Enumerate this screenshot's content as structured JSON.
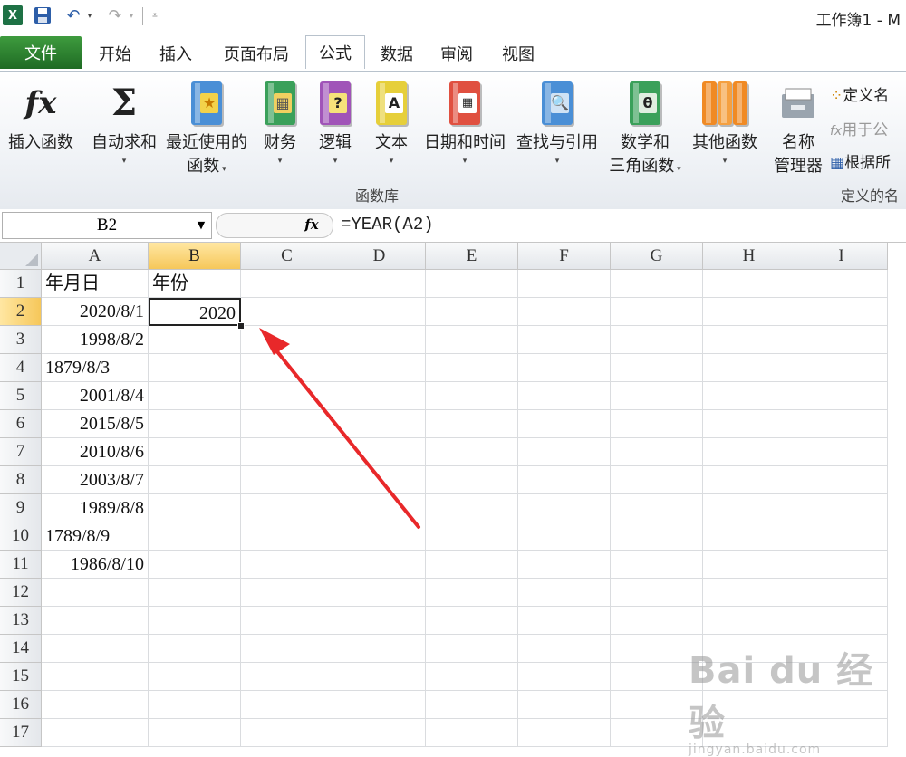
{
  "title_bar": {
    "document_title": "工作簿1 - M"
  },
  "tabs": [
    {
      "label": "文件"
    },
    {
      "label": "开始"
    },
    {
      "label": "插入"
    },
    {
      "label": "页面布局"
    },
    {
      "label": "公式",
      "active": true
    },
    {
      "label": "数据"
    },
    {
      "label": "审阅"
    },
    {
      "label": "视图"
    }
  ],
  "ribbon": {
    "insert_function": "插入函数",
    "autosum": "自动求和",
    "recent_1": "最近使用的",
    "recent_2": "函数",
    "financial": "财务",
    "logical": "逻辑",
    "text": "文本",
    "datetime": "日期和时间",
    "lookup": "查找与引用",
    "math_1": "数学和",
    "math_2": "三角函数",
    "more": "其他函数",
    "group_library": "函数库",
    "name_mgr_1": "名称",
    "name_mgr_2": "管理器",
    "define_name": "定义名",
    "use_in_formula": "用于公",
    "create_from_sel": "根据所",
    "group_defined": "定义的名"
  },
  "formula_bar": {
    "name_box": "B2",
    "fx": "fx",
    "formula": "=YEAR(A2)"
  },
  "columns": [
    "A",
    "B",
    "C",
    "D",
    "E",
    "F",
    "G",
    "H",
    "I"
  ],
  "rows": [
    "1",
    "2",
    "3",
    "4",
    "5",
    "6",
    "7",
    "8",
    "9",
    "10",
    "11",
    "12",
    "13",
    "14",
    "15",
    "16",
    "17"
  ],
  "cells": {
    "A1": "年月日",
    "B1": "年份",
    "A2": "2020/8/1",
    "B2": "2020",
    "A3": "1998/8/2",
    "A4": "1879/8/3",
    "A5": "2001/8/4",
    "A6": "2015/8/5",
    "A7": "2010/8/6",
    "A8": "2003/8/7",
    "A9": "1989/8/8",
    "A10": "1789/8/9",
    "A11": "1986/8/10"
  },
  "active_cell": "B2",
  "watermark": {
    "main": "Bai du 经验",
    "sub": "jingyan.baidu.com"
  }
}
